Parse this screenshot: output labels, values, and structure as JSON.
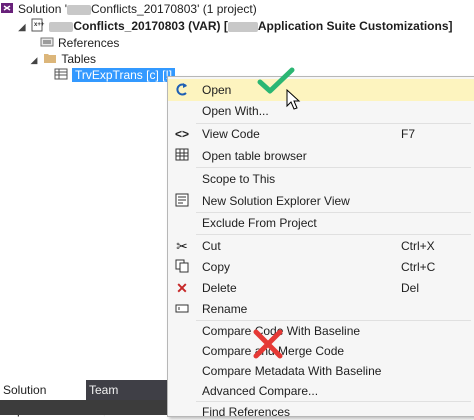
{
  "tree": {
    "solution": {
      "label_prefix": "Solution '",
      "label_suffix": "Conflicts_20170803' (1 project)"
    },
    "project": {
      "label_a": "Conflicts_20170803 (VAR) [",
      "label_b": "Application Suite Customizations]"
    },
    "references": "References",
    "tables": "Tables",
    "table_item": "TrvExpTrans [c] [!]"
  },
  "context_menu": {
    "items": [
      {
        "icon": "open-icon",
        "label": "Open",
        "shortcut": ""
      },
      {
        "icon": "",
        "label": "Open With...",
        "shortcut": ""
      },
      {
        "icon": "code-icon",
        "label": "View Code",
        "shortcut": "F7"
      },
      {
        "icon": "table-browser-icon",
        "label": "Open table browser",
        "shortcut": ""
      },
      {
        "icon": "",
        "label": "Scope to This",
        "shortcut": ""
      },
      {
        "icon": "new-view-icon",
        "label": "New Solution Explorer View",
        "shortcut": ""
      },
      {
        "icon": "",
        "label": "Exclude From Project",
        "shortcut": ""
      },
      {
        "icon": "cut-icon",
        "label": "Cut",
        "shortcut": "Ctrl+X"
      },
      {
        "icon": "copy-icon",
        "label": "Copy",
        "shortcut": "Ctrl+C"
      },
      {
        "icon": "delete-icon",
        "label": "Delete",
        "shortcut": "Del"
      },
      {
        "icon": "rename-icon",
        "label": "Rename",
        "shortcut": ""
      },
      {
        "icon": "",
        "label": "Compare Code With Baseline",
        "shortcut": ""
      },
      {
        "icon": "",
        "label": "Compare and Merge Code",
        "shortcut": ""
      },
      {
        "icon": "",
        "label": "Compare Metadata With Baseline",
        "shortcut": ""
      },
      {
        "icon": "",
        "label": "Advanced Compare...",
        "shortcut": ""
      },
      {
        "icon": "",
        "label": "Find References",
        "shortcut": ""
      }
    ]
  },
  "tabs": [
    "Solution Explorer",
    "Team Explorer"
  ],
  "colors": {
    "check": "#2bb673",
    "cross": "#e53935",
    "highlight": "#fdf4bf",
    "selection": "#3399ff"
  }
}
